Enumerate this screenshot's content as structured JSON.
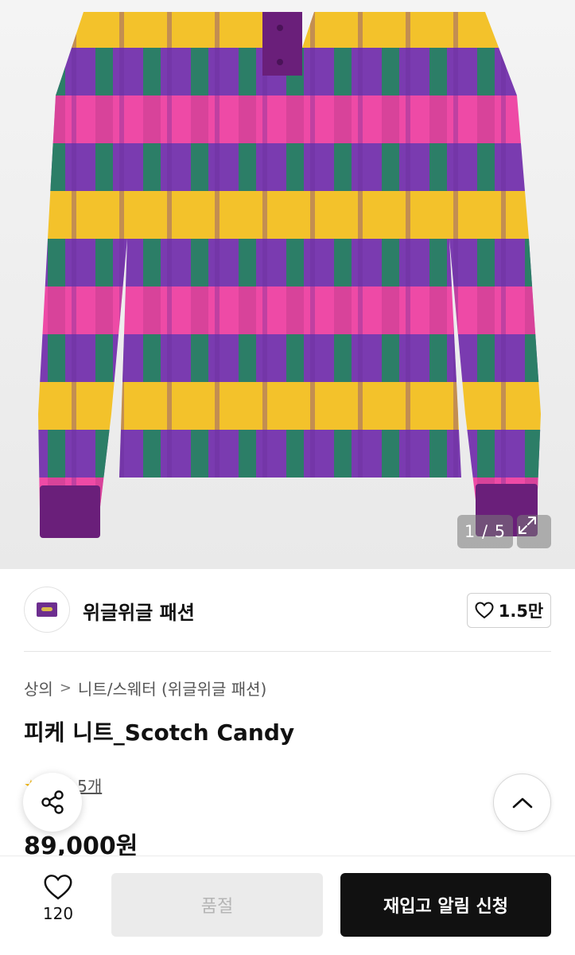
{
  "gallery": {
    "counter": "1 / 5",
    "expand_icon": "expand-icon"
  },
  "brand": {
    "name": "위글위글 패션",
    "likes": "1.5만",
    "logo_color": "#6d2e8f"
  },
  "product": {
    "breadcrumb": [
      "상의",
      "니트/스웨터 (위글위글 패션)"
    ],
    "title": "피케 니트_Scotch Candy",
    "review_link": "후기 5개",
    "price": "89,000원"
  },
  "bottom_bar": {
    "wish_count": "120",
    "soldout_label": "품절",
    "restock_label": "재입고 알림 신청"
  },
  "colors": {
    "purple": "#7a3bb0",
    "pink": "#ee4aa6",
    "yellow": "#f3c22b",
    "green": "#1f8a5a",
    "primary_button": "#111111",
    "disabled_button": "#ebebeb"
  }
}
